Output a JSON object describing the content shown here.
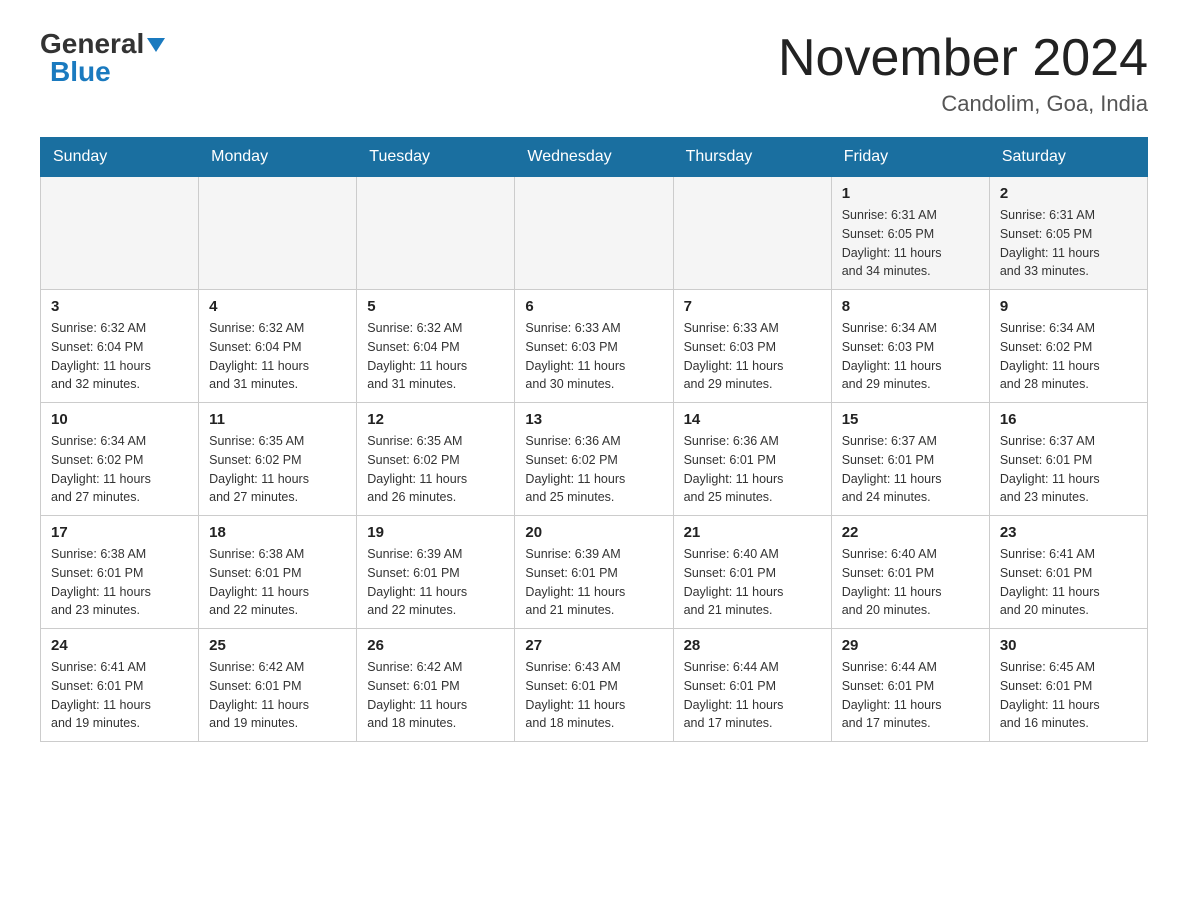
{
  "header": {
    "logo": {
      "general": "General",
      "blue": "Blue",
      "triangle_color": "#1a7abf"
    },
    "title": "November 2024",
    "location": "Candolim, Goa, India"
  },
  "calendar": {
    "days_of_week": [
      "Sunday",
      "Monday",
      "Tuesday",
      "Wednesday",
      "Thursday",
      "Friday",
      "Saturday"
    ],
    "weeks": [
      {
        "days": [
          {
            "date": "",
            "info": ""
          },
          {
            "date": "",
            "info": ""
          },
          {
            "date": "",
            "info": ""
          },
          {
            "date": "",
            "info": ""
          },
          {
            "date": "",
            "info": ""
          },
          {
            "date": "1",
            "info": "Sunrise: 6:31 AM\nSunset: 6:05 PM\nDaylight: 11 hours\nand 34 minutes."
          },
          {
            "date": "2",
            "info": "Sunrise: 6:31 AM\nSunset: 6:05 PM\nDaylight: 11 hours\nand 33 minutes."
          }
        ]
      },
      {
        "days": [
          {
            "date": "3",
            "info": "Sunrise: 6:32 AM\nSunset: 6:04 PM\nDaylight: 11 hours\nand 32 minutes."
          },
          {
            "date": "4",
            "info": "Sunrise: 6:32 AM\nSunset: 6:04 PM\nDaylight: 11 hours\nand 31 minutes."
          },
          {
            "date": "5",
            "info": "Sunrise: 6:32 AM\nSunset: 6:04 PM\nDaylight: 11 hours\nand 31 minutes."
          },
          {
            "date": "6",
            "info": "Sunrise: 6:33 AM\nSunset: 6:03 PM\nDaylight: 11 hours\nand 30 minutes."
          },
          {
            "date": "7",
            "info": "Sunrise: 6:33 AM\nSunset: 6:03 PM\nDaylight: 11 hours\nand 29 minutes."
          },
          {
            "date": "8",
            "info": "Sunrise: 6:34 AM\nSunset: 6:03 PM\nDaylight: 11 hours\nand 29 minutes."
          },
          {
            "date": "9",
            "info": "Sunrise: 6:34 AM\nSunset: 6:02 PM\nDaylight: 11 hours\nand 28 minutes."
          }
        ]
      },
      {
        "days": [
          {
            "date": "10",
            "info": "Sunrise: 6:34 AM\nSunset: 6:02 PM\nDaylight: 11 hours\nand 27 minutes."
          },
          {
            "date": "11",
            "info": "Sunrise: 6:35 AM\nSunset: 6:02 PM\nDaylight: 11 hours\nand 27 minutes."
          },
          {
            "date": "12",
            "info": "Sunrise: 6:35 AM\nSunset: 6:02 PM\nDaylight: 11 hours\nand 26 minutes."
          },
          {
            "date": "13",
            "info": "Sunrise: 6:36 AM\nSunset: 6:02 PM\nDaylight: 11 hours\nand 25 minutes."
          },
          {
            "date": "14",
            "info": "Sunrise: 6:36 AM\nSunset: 6:01 PM\nDaylight: 11 hours\nand 25 minutes."
          },
          {
            "date": "15",
            "info": "Sunrise: 6:37 AM\nSunset: 6:01 PM\nDaylight: 11 hours\nand 24 minutes."
          },
          {
            "date": "16",
            "info": "Sunrise: 6:37 AM\nSunset: 6:01 PM\nDaylight: 11 hours\nand 23 minutes."
          }
        ]
      },
      {
        "days": [
          {
            "date": "17",
            "info": "Sunrise: 6:38 AM\nSunset: 6:01 PM\nDaylight: 11 hours\nand 23 minutes."
          },
          {
            "date": "18",
            "info": "Sunrise: 6:38 AM\nSunset: 6:01 PM\nDaylight: 11 hours\nand 22 minutes."
          },
          {
            "date": "19",
            "info": "Sunrise: 6:39 AM\nSunset: 6:01 PM\nDaylight: 11 hours\nand 22 minutes."
          },
          {
            "date": "20",
            "info": "Sunrise: 6:39 AM\nSunset: 6:01 PM\nDaylight: 11 hours\nand 21 minutes."
          },
          {
            "date": "21",
            "info": "Sunrise: 6:40 AM\nSunset: 6:01 PM\nDaylight: 11 hours\nand 21 minutes."
          },
          {
            "date": "22",
            "info": "Sunrise: 6:40 AM\nSunset: 6:01 PM\nDaylight: 11 hours\nand 20 minutes."
          },
          {
            "date": "23",
            "info": "Sunrise: 6:41 AM\nSunset: 6:01 PM\nDaylight: 11 hours\nand 20 minutes."
          }
        ]
      },
      {
        "days": [
          {
            "date": "24",
            "info": "Sunrise: 6:41 AM\nSunset: 6:01 PM\nDaylight: 11 hours\nand 19 minutes."
          },
          {
            "date": "25",
            "info": "Sunrise: 6:42 AM\nSunset: 6:01 PM\nDaylight: 11 hours\nand 19 minutes."
          },
          {
            "date": "26",
            "info": "Sunrise: 6:42 AM\nSunset: 6:01 PM\nDaylight: 11 hours\nand 18 minutes."
          },
          {
            "date": "27",
            "info": "Sunrise: 6:43 AM\nSunset: 6:01 PM\nDaylight: 11 hours\nand 18 minutes."
          },
          {
            "date": "28",
            "info": "Sunrise: 6:44 AM\nSunset: 6:01 PM\nDaylight: 11 hours\nand 17 minutes."
          },
          {
            "date": "29",
            "info": "Sunrise: 6:44 AM\nSunset: 6:01 PM\nDaylight: 11 hours\nand 17 minutes."
          },
          {
            "date": "30",
            "info": "Sunrise: 6:45 AM\nSunset: 6:01 PM\nDaylight: 11 hours\nand 16 minutes."
          }
        ]
      }
    ]
  }
}
